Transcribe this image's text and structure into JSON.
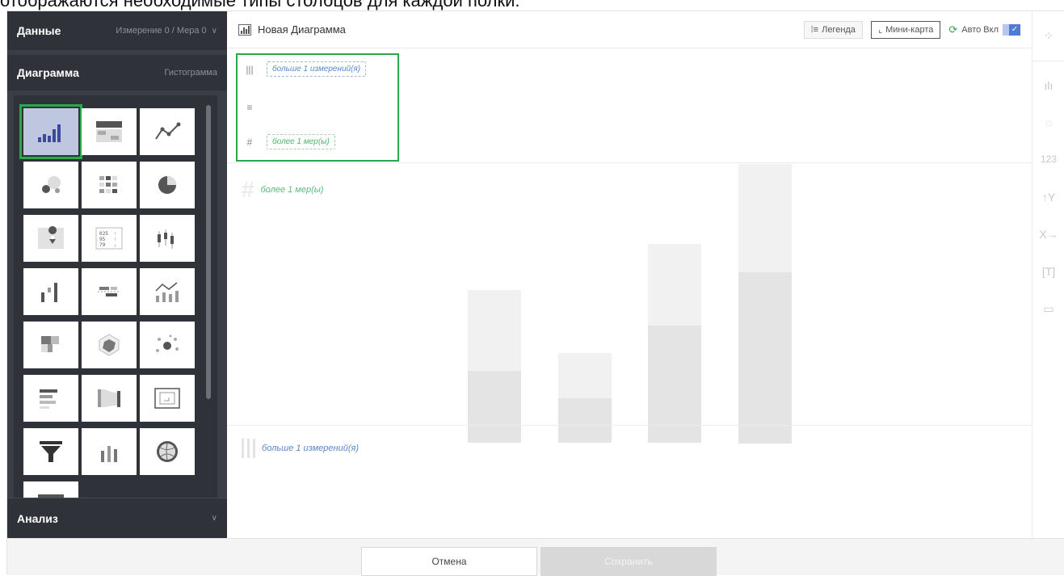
{
  "caption": "отображаются необходимые типы столбцов для каждой полки.",
  "sidebar": {
    "data_title": "Данные",
    "data_sub": "Измерение 0 / Мера 0",
    "chart_title": "Диаграмма",
    "chart_sub": "Гистограмма",
    "analysis_title": "Анализ"
  },
  "header": {
    "title": "Новая Диаграмма",
    "legend_label": "Легенда",
    "minimap_label": "Мини-карта",
    "auto_label": "Авто Вкл"
  },
  "shelves": {
    "dimension_hint": "больше 1 измерений(я)",
    "measure_hint": "более 1 мер(ы)"
  },
  "canvas": {
    "y_hint": "более 1 мер(ы)",
    "x_hint": "больше 1 измерений(я)"
  },
  "rail": {
    "number_label": "123"
  },
  "footer": {
    "cancel_label": "Отмена",
    "save_label": "Сохранить"
  },
  "colors": {
    "sidebar_bg": "#3a3e45",
    "selection_outline": "#2aa84a",
    "dimension_blue": "#5a87c7",
    "measure_green": "#47b46b"
  }
}
